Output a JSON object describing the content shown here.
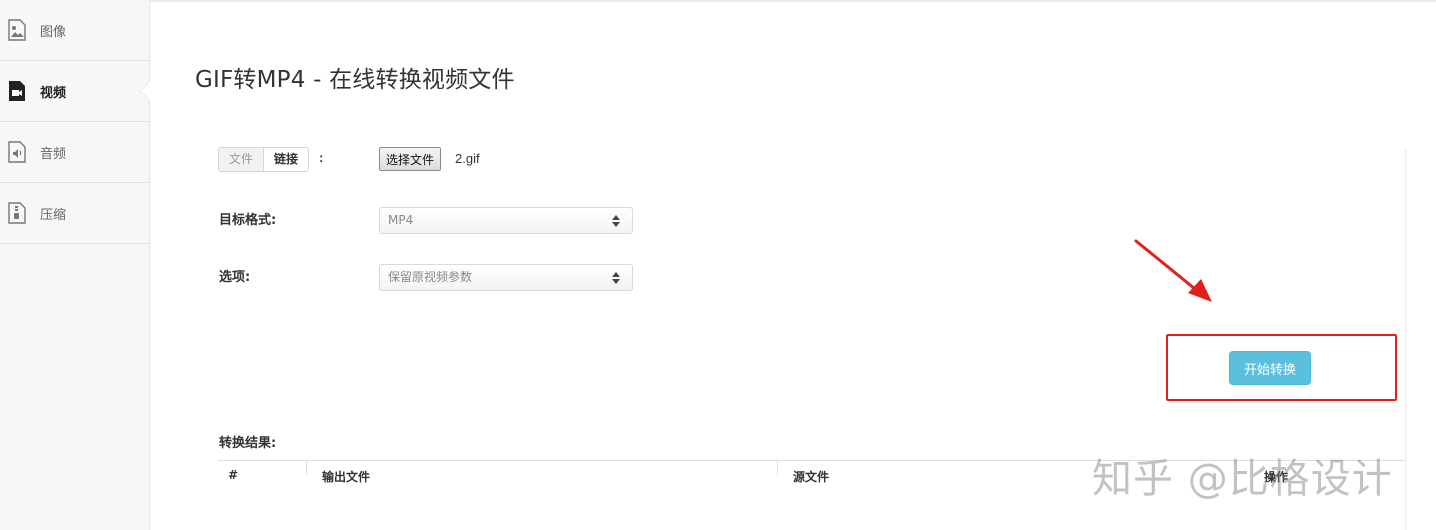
{
  "sidebar": {
    "items": [
      {
        "label": "图像",
        "icon": "image-icon",
        "active": false
      },
      {
        "label": "视频",
        "icon": "video-icon",
        "active": true
      },
      {
        "label": "音频",
        "icon": "audio-icon",
        "active": false
      },
      {
        "label": "压缩",
        "icon": "archive-icon",
        "active": false
      }
    ]
  },
  "page": {
    "title": "GIF转MP4 - 在线转换视频文件"
  },
  "form": {
    "source_toggle": {
      "file_label": "文件",
      "link_label": "链接",
      "colon": ":"
    },
    "file_button_label": "选择文件",
    "file_name": "2.gif",
    "target_format": {
      "label": "目标格式:",
      "selected": "MP4"
    },
    "options": {
      "label": "选项:",
      "selected": "保留原视频参数"
    },
    "start_button_label": "开始转换"
  },
  "annotation": {
    "color": "#e0201b"
  },
  "results": {
    "title": "转换结果:",
    "columns": [
      "#",
      "输出文件",
      "源文件",
      "操作"
    ]
  },
  "watermark": "知乎 @比格设计",
  "colors": {
    "accent_button": "#5bc0de",
    "sidebar_bg": "#f7f7f7"
  }
}
